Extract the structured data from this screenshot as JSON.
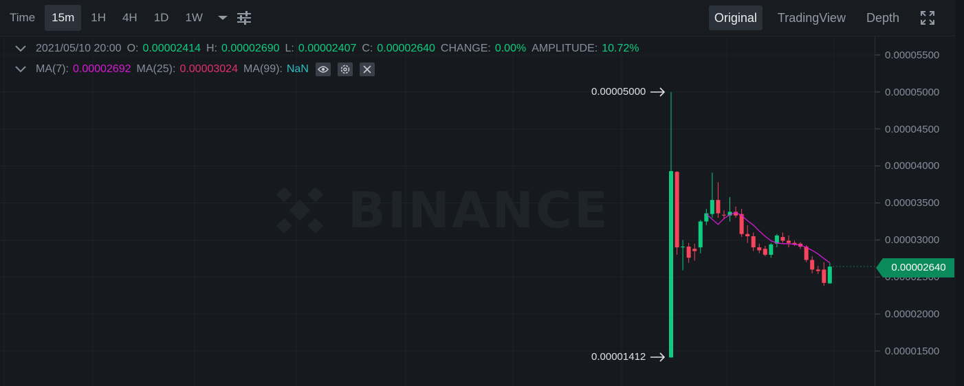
{
  "toolbar": {
    "intervals": [
      {
        "label": "Time",
        "active": false
      },
      {
        "label": "15m",
        "active": true
      },
      {
        "label": "1H",
        "active": false
      },
      {
        "label": "4H",
        "active": false
      },
      {
        "label": "1D",
        "active": false
      },
      {
        "label": "1W",
        "active": false
      }
    ],
    "views": [
      {
        "label": "Original",
        "active": true
      },
      {
        "label": "TradingView",
        "active": false
      },
      {
        "label": "Depth",
        "active": false
      }
    ]
  },
  "legend": {
    "date": "2021/05/10 20:00",
    "open_label": "O:",
    "open": "0.00002414",
    "high_label": "H:",
    "high": "0.00002690",
    "low_label": "L:",
    "low": "0.00002407",
    "close_label": "C:",
    "close": "0.00002640",
    "change_label": "CHANGE:",
    "change": "0.00%",
    "amplitude_label": "AMPLITUDE:",
    "amplitude": "10.72%",
    "ma7_label": "MA(7):",
    "ma7": "0.00002692",
    "ma25_label": "MA(25):",
    "ma25": "0.00003024",
    "ma99_label": "MA(99):",
    "ma99": "NaN"
  },
  "watermark": "BINANCE",
  "price_axis": {
    "labels": [
      "0.00005500",
      "0.00005000",
      "0.00004500",
      "0.00004000",
      "0.00003500",
      "0.00003000",
      "0.00002500",
      "0.00002000",
      "0.00001500"
    ],
    "current_price": "0.00002640"
  },
  "extremes": {
    "high_label": "0.00005000",
    "low_label": "0.00001412"
  },
  "colors": {
    "up": "#0ECB81",
    "down": "#F6465D",
    "ma7": "#D51AD5",
    "ma25": "#E0306A",
    "ma99": "#2EBDBF",
    "background": "#161A1E"
  },
  "chart_data": {
    "type": "candlestick",
    "ylim": [
      1.31e-05,
      5.65e-05
    ],
    "candles": [
      {
        "o": 1.412e-05,
        "h": 5e-05,
        "l": 1.412e-05,
        "c": 3.93e-05
      },
      {
        "o": 3.92e-05,
        "h": 3.93e-05,
        "l": 2.8e-05,
        "c": 2.9e-05
      },
      {
        "o": 2.9e-05,
        "h": 3e-05,
        "l": 2.59e-05,
        "c": 2.91e-05
      },
      {
        "o": 2.91e-05,
        "h": 2.96e-05,
        "l": 2.69e-05,
        "c": 2.76e-05
      },
      {
        "o": 2.88e-05,
        "h": 2.95e-05,
        "l": 2.72e-05,
        "c": 2.85e-05
      },
      {
        "o": 2.9e-05,
        "h": 3.27e-05,
        "l": 2.82e-05,
        "c": 3.25e-05
      },
      {
        "o": 3.25e-05,
        "h": 3.42e-05,
        "l": 3.2e-05,
        "c": 3.36e-05
      },
      {
        "o": 3.35e-05,
        "h": 3.91e-05,
        "l": 3.3e-05,
        "c": 3.54e-05
      },
      {
        "o": 3.54e-05,
        "h": 3.78e-05,
        "l": 3.3e-05,
        "c": 3.36e-05
      },
      {
        "o": 3.34e-05,
        "h": 3.4e-05,
        "l": 3.28e-05,
        "c": 3.33e-05
      },
      {
        "o": 3.33e-05,
        "h": 3.58e-05,
        "l": 3.25e-05,
        "c": 3.38e-05
      },
      {
        "o": 3.38e-05,
        "h": 3.45e-05,
        "l": 3.3e-05,
        "c": 3.33e-05
      },
      {
        "o": 3.35e-05,
        "h": 3.42e-05,
        "l": 3.04e-05,
        "c": 3.08e-05
      },
      {
        "o": 3.08e-05,
        "h": 3.2e-05,
        "l": 2.96e-05,
        "c": 3.05e-05
      },
      {
        "o": 3.05e-05,
        "h": 3.1e-05,
        "l": 2.85e-05,
        "c": 2.9e-05
      },
      {
        "o": 2.9e-05,
        "h": 2.95e-05,
        "l": 2.82e-05,
        "c": 2.86e-05
      },
      {
        "o": 2.88e-05,
        "h": 2.92e-05,
        "l": 2.78e-05,
        "c": 2.8e-05
      },
      {
        "o": 2.8e-05,
        "h": 2.96e-05,
        "l": 2.76e-05,
        "c": 2.94e-05
      },
      {
        "o": 2.95e-05,
        "h": 3.08e-05,
        "l": 2.9e-05,
        "c": 3.06e-05
      },
      {
        "o": 3.04e-05,
        "h": 3.1e-05,
        "l": 2.96e-05,
        "c": 2.99e-05
      },
      {
        "o": 2.99e-05,
        "h": 3.06e-05,
        "l": 2.9e-05,
        "c": 2.96e-05
      },
      {
        "o": 2.96e-05,
        "h": 2.99e-05,
        "l": 2.92e-05,
        "c": 2.94e-05
      },
      {
        "o": 2.95e-05,
        "h": 2.97e-05,
        "l": 2.88e-05,
        "c": 2.91e-05
      },
      {
        "o": 2.91e-05,
        "h": 2.93e-05,
        "l": 2.7e-05,
        "c": 2.73e-05
      },
      {
        "o": 2.73e-05,
        "h": 2.78e-05,
        "l": 2.55e-05,
        "c": 2.6e-05
      },
      {
        "o": 2.6e-05,
        "h": 2.65e-05,
        "l": 2.54e-05,
        "c": 2.58e-05
      },
      {
        "o": 2.6e-05,
        "h": 2.7e-05,
        "l": 2.38e-05,
        "c": 2.42e-05
      },
      {
        "o": 2.414e-05,
        "h": 2.69e-05,
        "l": 2.407e-05,
        "c": 2.64e-05
      }
    ],
    "ma7": [
      null,
      null,
      null,
      null,
      null,
      null,
      3.35e-05,
      3.28e-05,
      3.21e-05,
      3.29e-05,
      3.34e-05,
      3.37e-05,
      3.33e-05,
      3.26e-05,
      3.2e-05,
      3.12e-05,
      3.05e-05,
      2.99e-05,
      2.96e-05,
      2.95e-05,
      2.95e-05,
      2.94e-05,
      2.93e-05,
      2.9e-05,
      2.86e-05,
      2.81e-05,
      2.75e-05,
      2.692e-05
    ]
  }
}
